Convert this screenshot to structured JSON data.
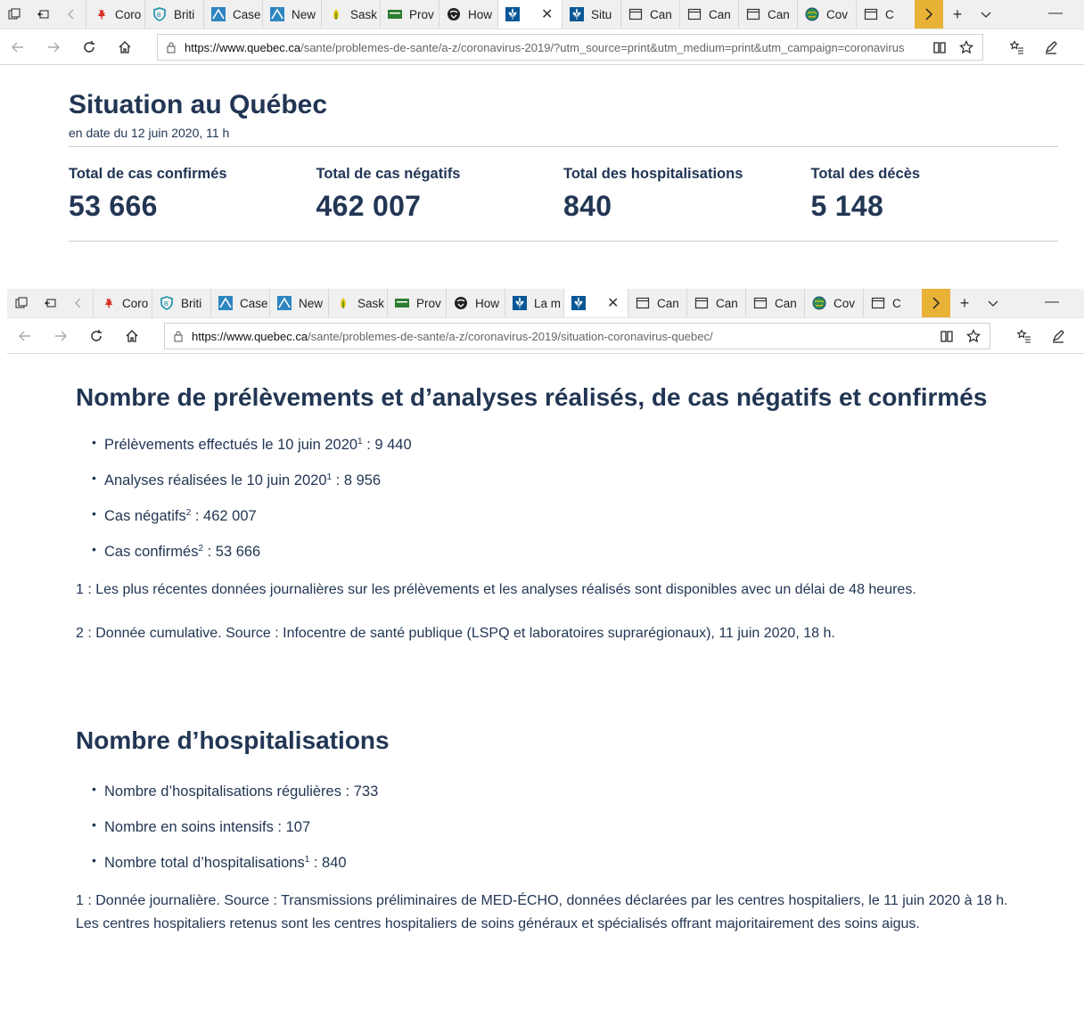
{
  "window1": {
    "tabs": [
      {
        "label": "Coro",
        "icon": "maple-leaf-icon"
      },
      {
        "label": "Briti",
        "icon": "bc-shield-icon"
      },
      {
        "label": "Case",
        "icon": "alberta-icon"
      },
      {
        "label": "New",
        "icon": "alberta-icon"
      },
      {
        "label": "Sask",
        "icon": "sask-icon"
      },
      {
        "label": "Prov",
        "icon": "manitoba-icon"
      },
      {
        "label": "How",
        "icon": "ontario-icon"
      },
      {
        "label": "",
        "icon": "quebec-fleur-icon",
        "active": true
      },
      {
        "label": "Situ",
        "icon": "quebec-fleur-icon"
      },
      {
        "label": "Can",
        "icon": "window-icon"
      },
      {
        "label": "Can",
        "icon": "window-icon"
      },
      {
        "label": "Can",
        "icon": "window-icon"
      },
      {
        "label": "Cov",
        "icon": "globe-icon"
      },
      {
        "label": "C",
        "icon": "window-icon"
      }
    ],
    "url_domain": "https://www.quebec.ca",
    "url_path": "/sante/problemes-de-sante/a-z/coronavirus-2019/?utm_source=print&utm_medium=print&utm_campaign=coronavirus"
  },
  "page1": {
    "title": "Situation au Québec",
    "date": "en date du 12 juin 2020, 11 h",
    "stats": [
      {
        "label": "Total de cas confirmés",
        "value": "53 666"
      },
      {
        "label": "Total de cas négatifs",
        "value": "462 007"
      },
      {
        "label": "Total des hospitalisations",
        "value": "840"
      },
      {
        "label": "Total des décès",
        "value": "5 148"
      }
    ]
  },
  "window2": {
    "tabs": [
      {
        "label": "Coro",
        "icon": "maple-leaf-icon"
      },
      {
        "label": "Briti",
        "icon": "bc-shield-icon"
      },
      {
        "label": "Case",
        "icon": "alberta-icon"
      },
      {
        "label": "New",
        "icon": "alberta-icon"
      },
      {
        "label": "Sask",
        "icon": "sask-icon"
      },
      {
        "label": "Prov",
        "icon": "manitoba-icon"
      },
      {
        "label": "How",
        "icon": "ontario-icon"
      },
      {
        "label": "La m",
        "icon": "quebec-fleur-icon"
      },
      {
        "label": "",
        "icon": "quebec-fleur-icon",
        "active": true
      },
      {
        "label": "Can",
        "icon": "window-icon"
      },
      {
        "label": "Can",
        "icon": "window-icon"
      },
      {
        "label": "Can",
        "icon": "window-icon"
      },
      {
        "label": "Cov",
        "icon": "globe-icon"
      },
      {
        "label": "C",
        "icon": "window-icon"
      }
    ],
    "url_domain": "https://www.quebec.ca",
    "url_path": "/sante/problemes-de-sante/a-z/coronavirus-2019/situation-coronavirus-quebec/"
  },
  "page2": {
    "section1": {
      "heading": "Nombre de prélèvements et d’analyses réalisés, de cas négatifs et confirmés",
      "items": [
        {
          "text": "Prélèvements effectués le 10 juin 2020",
          "sup": "1",
          "value": " : 9 440"
        },
        {
          "text": "Analyses réalisées le 10 juin 2020",
          "sup": "1",
          "value": " : 8 956"
        },
        {
          "text": "Cas négatifs",
          "sup": "2",
          "value": " : 462 007"
        },
        {
          "text": "Cas confirmés",
          "sup": "2",
          "value": " : 53 666"
        }
      ],
      "note1": "1 : Les plus récentes données journalières sur les prélèvements et les analyses réalisés sont disponibles avec un délai de 48 heures.",
      "note2": "2 : Donnée cumulative. Source : Infocentre de santé publique (LSPQ et laboratoires suprarégionaux), 11 juin 2020, 18 h."
    },
    "section2": {
      "heading": "Nombre d’hospitalisations",
      "items": [
        {
          "text": "Nombre d’hospitalisations régulières : 733",
          "sup": "",
          "value": ""
        },
        {
          "text": "Nombre en soins intensifs : 107",
          "sup": "",
          "value": ""
        },
        {
          "text": "Nombre total d’hospitalisations",
          "sup": "1",
          "value": " : 840"
        }
      ],
      "note1": "1 : Donnée journalière. Source : Transmissions préliminaires de MED-ÉCHO, données déclarées par les centres hospitaliers, le 11 juin 2020 à 18 h.",
      "note2": "Les centres hospitaliers retenus sont les centres hospitaliers de soins généraux et spécialisés offrant majoritairement des soins aigus."
    }
  }
}
